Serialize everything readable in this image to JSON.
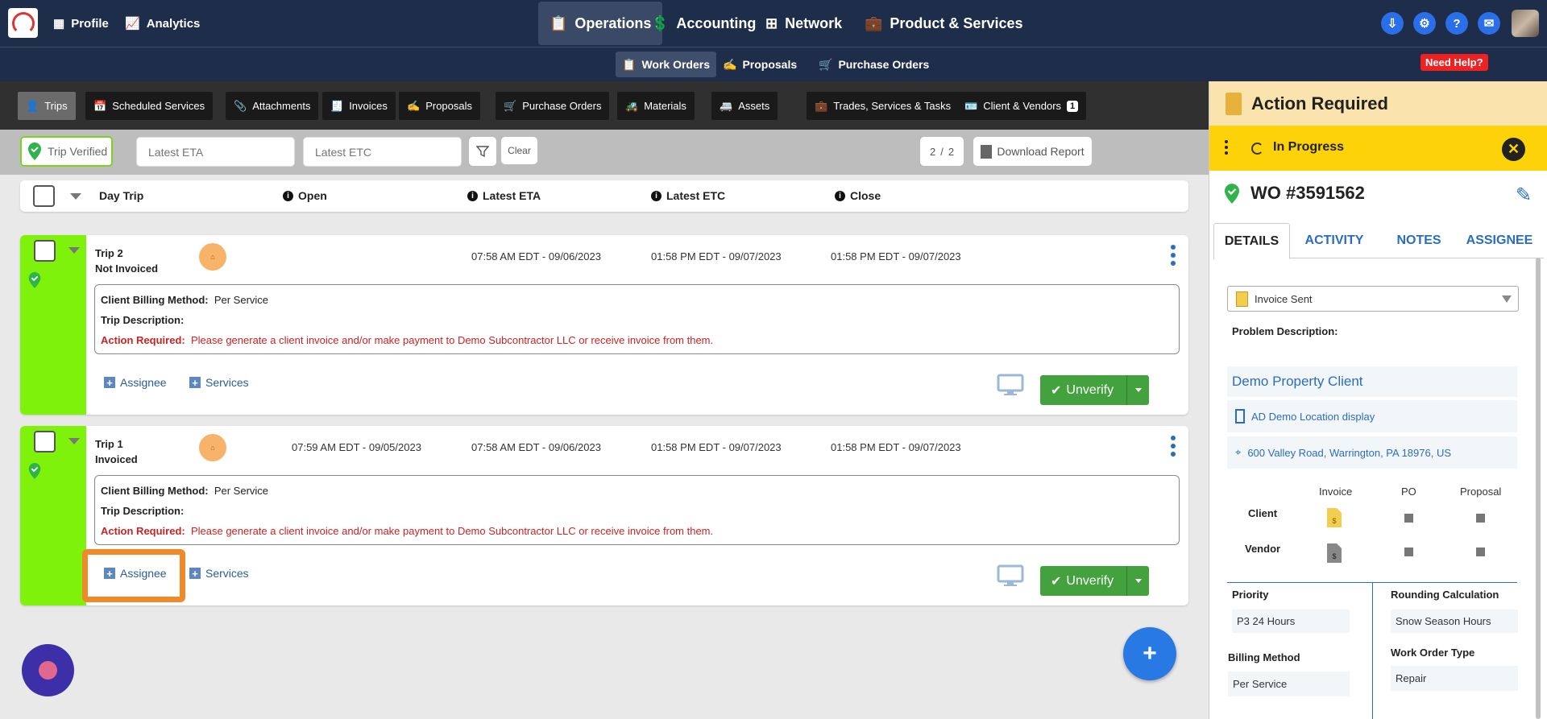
{
  "topnav": {
    "profile": "Profile",
    "analytics": "Analytics",
    "operations": "Operations",
    "accounting": "Accounting",
    "network": "Network",
    "products": "Product & Services"
  },
  "subnav": {
    "work_orders": "Work Orders",
    "proposals": "Proposals",
    "purchase_orders": "Purchase Orders",
    "need_help": "Need Help?"
  },
  "tabs": {
    "trips": "Trips",
    "scheduled": "Scheduled Services",
    "attachments": "Attachments",
    "invoices": "Invoices",
    "proposals": "Proposals",
    "purchase_orders": "Purchase Orders",
    "materials": "Materials",
    "assets": "Assets",
    "trades": "Trades, Services & Tasks",
    "clients": "Client & Vendors",
    "clients_count": "1"
  },
  "filters": {
    "trip_verified": "Trip Verified",
    "eta_placeholder": "Latest ETA",
    "etc_placeholder": "Latest ETC",
    "clear": "Clear",
    "page_current": "2",
    "page_sep": "/",
    "page_total": "2",
    "download": "Download Report"
  },
  "columns": {
    "day_trip": "Day Trip",
    "open": "Open",
    "eta": "Latest ETA",
    "etc": "Latest ETC",
    "close": "Close"
  },
  "trips": [
    {
      "title": "Trip 2",
      "status": "Not Invoiced",
      "open": "",
      "eta": "07:58 AM EDT - 09/06/2023",
      "etc": "01:58 PM EDT - 09/07/2023",
      "close": "01:58 PM EDT - 09/07/2023",
      "billing_label": "Client Billing Method:",
      "billing_value": "Per Service",
      "desc_label": "Trip Description:",
      "action_label": "Action Required:",
      "action_text": "Please generate a client invoice and/or make payment to Demo Subcontractor LLC or receive invoice from them.",
      "assignee": "Assignee",
      "services": "Services",
      "unverify": "Unverify"
    },
    {
      "title": "Trip 1",
      "status": "Invoiced",
      "open": "07:59 AM EDT - 09/05/2023",
      "eta": "07:58 AM EDT - 09/06/2023",
      "etc": "01:58 PM EDT - 09/07/2023",
      "close": "01:58 PM EDT - 09/07/2023",
      "billing_label": "Client Billing Method:",
      "billing_value": "Per Service",
      "desc_label": "Trip Description:",
      "action_label": "Action Required:",
      "action_text": "Please generate a client invoice and/or make payment to Demo Subcontractor LLC or receive invoice from them.",
      "assignee": "Assignee",
      "services": "Services",
      "unverify": "Unverify"
    }
  ],
  "panel": {
    "action_required": "Action Required",
    "status": "In Progress",
    "wo_number": "WO #3591562",
    "tabs": [
      "DETAILS",
      "ACTIVITY",
      "NOTES",
      "ASSIGNEE"
    ],
    "invoice_status": "Invoice Sent",
    "problem_label": "Problem Description:",
    "client_name": "Demo Property Client",
    "location": "AD Demo Location display",
    "address": "600 Valley Road, Warrington, PA 18976, US",
    "matrix_cols": [
      "Invoice",
      "PO",
      "Proposal"
    ],
    "matrix_rows": [
      "Client",
      "Vendor"
    ],
    "priority_label": "Priority",
    "priority_value": "P3 24 Hours",
    "rounding_label": "Rounding Calculation",
    "rounding_value": "Snow Season Hours",
    "billing_label": "Billing Method",
    "billing_value": "Per Service",
    "wo_type_label": "Work Order Type",
    "wo_type_value": "Repair"
  },
  "colors": {
    "nav_bg": "#1d2d4a",
    "verified_strip": "#7ef20b",
    "unverify_green": "#43a23e",
    "highlight_orange": "#ef8a2a",
    "status_yellow": "#fdd208",
    "link_blue": "#2a6dbf"
  }
}
